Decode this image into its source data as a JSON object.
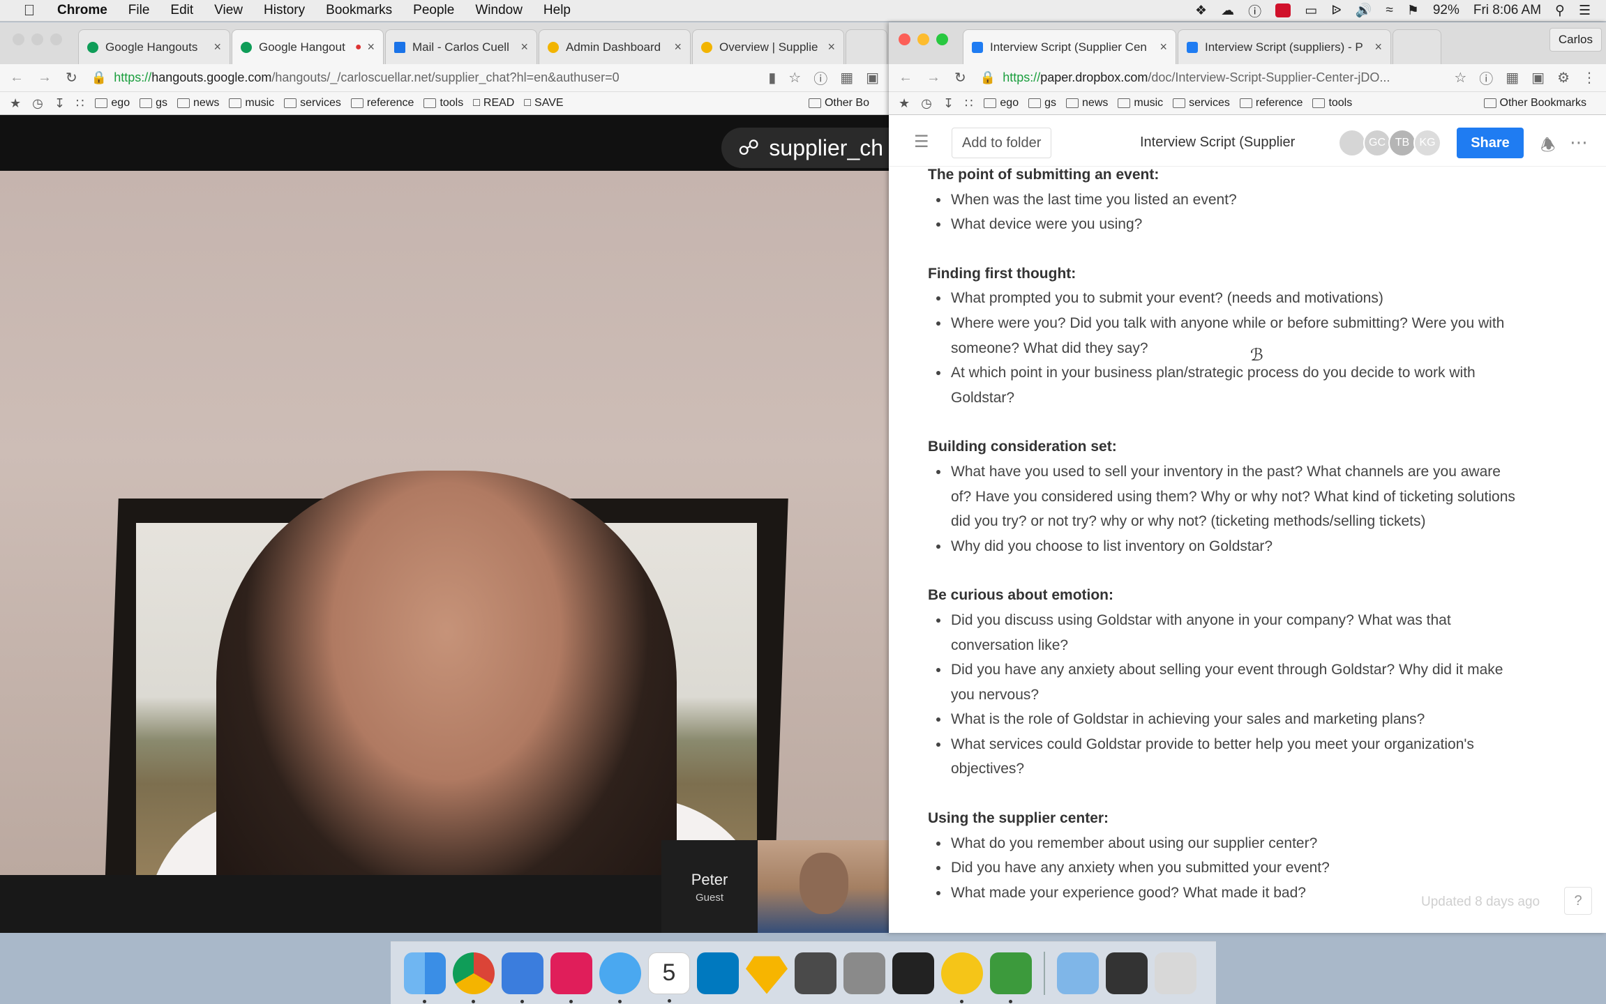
{
  "menubar": {
    "apple": "",
    "app": "Chrome",
    "menus": [
      "File",
      "Edit",
      "View",
      "History",
      "Bookmarks",
      "People",
      "Window",
      "Help"
    ],
    "battery": "92%",
    "clock": "Fri 8:06 AM"
  },
  "left_window": {
    "tabs": [
      {
        "label": "Google Hangouts",
        "color": "#0f9d58"
      },
      {
        "label": "Google Hangout",
        "color": "#0f9d58"
      },
      {
        "label": "Mail - Carlos Cuell",
        "color": "#1a73e8"
      },
      {
        "label": "Admin Dashboard",
        "color": "#f2b400"
      },
      {
        "label": "Overview | Supplie",
        "color": "#f2b400"
      }
    ],
    "url_scheme": "https://",
    "url_domain": "hangouts.google.com",
    "url_path": "/hangouts/_/carloscuellar.net/supplier_chat?hl=en&authuser=0",
    "bookmarks": [
      "ego",
      "gs",
      "news",
      "music",
      "services",
      "reference",
      "tools",
      "READ",
      "SAVE"
    ],
    "other_bookmarks": "Other Bo",
    "chat_name": "supplier_ch",
    "peer_name": "Peter",
    "peer_role": "Guest"
  },
  "right_window": {
    "profile": "Carlos",
    "tabs": [
      {
        "label": "Interview Script (Supplier Cen",
        "color": "#1f7cf2"
      },
      {
        "label": "Interview Script (suppliers) - P",
        "color": "#1f7cf2"
      }
    ],
    "url_scheme": "https://",
    "url_domain": "paper.dropbox.com",
    "url_path": "/doc/Interview-Script-Supplier-Center-jDO...",
    "bookmarks": [
      "ego",
      "gs",
      "news",
      "music",
      "services",
      "reference",
      "tools"
    ],
    "other_bookmarks": "Other Bookmarks",
    "add_to_folder": "Add to folder",
    "doc_title": "Interview Script (Supplier",
    "avatars": [
      {
        "initials": "",
        "color": "#d6d6d6"
      },
      {
        "initials": "GC",
        "color": "#d0d0d0"
      },
      {
        "initials": "TB",
        "color": "#b5b5b5"
      },
      {
        "initials": "KG",
        "color": "#dcdcdc"
      }
    ],
    "share": "Share",
    "updated": "Updated 8 days ago",
    "help": "?"
  },
  "document": {
    "sections": [
      {
        "heading": "The point of submitting an event:",
        "items": [
          "When was the last time you listed an event?",
          "What device were you using?"
        ]
      },
      {
        "heading": "Finding first thought:",
        "items": [
          "What prompted you to submit your event? (needs and motivations)",
          "Where were you? Did you talk with anyone while or before submitting?  Were you with someone? What did they say?",
          "At which point in your business plan/strategic process do you decide to work with Goldstar?"
        ]
      },
      {
        "heading": "Building consideration set:",
        "items": [
          "What have you used to sell your inventory in the past? What channels are you aware of? Have you considered using them? Why or why not? What kind of ticketing solutions did you try? or not try? why or why not? (ticketing methods/selling tickets)",
          "Why did you choose to list inventory on Goldstar?"
        ]
      },
      {
        "heading": "Be curious about emotion:",
        "items": [
          "Did you discuss using Goldstar with anyone in your company? What was that conversation like?",
          "Did you have any anxiety about selling your event through Goldstar? Why did it make you nervous?",
          "What is the role of Goldstar in achieving your sales and marketing plans?",
          "What services could Goldstar provide to better help you meet your organization's objectives?"
        ]
      },
      {
        "heading": "Using the supplier center:",
        "items": [
          "What do you remember about using our supplier center?",
          "Did you have any anxiety when you submitted your event?",
          "What made your experience good? What made it bad?"
        ]
      }
    ]
  },
  "dock": {
    "apps": [
      {
        "name": "finder-icon",
        "color": "#3a8ee6"
      },
      {
        "name": "chrome-icon",
        "color": "#db4437"
      },
      {
        "name": "airmail-icon",
        "color": "#3b7ddd"
      },
      {
        "name": "slack-icon",
        "color": "#e01e5a"
      },
      {
        "name": "messages-icon",
        "color": "#4aa8f0"
      },
      {
        "name": "calendar-icon",
        "color": "#ffffff"
      },
      {
        "name": "trello-icon",
        "color": "#0079bf"
      },
      {
        "name": "sketch-icon",
        "color": "#f7b500"
      },
      {
        "name": "sublime-icon",
        "color": "#4a4a4a"
      },
      {
        "name": "trash-drawer-icon",
        "color": "#8a8a8a"
      },
      {
        "name": "terminal-icon",
        "color": "#222222"
      },
      {
        "name": "idea-icon",
        "color": "#f5c518"
      },
      {
        "name": "camtasia-icon",
        "color": "#3c9a3c"
      },
      {
        "name": "folder-icon",
        "color": "#7fb6e8"
      },
      {
        "name": "screen-icon",
        "color": "#333333"
      },
      {
        "name": "trash-icon",
        "color": "#d8d8d8"
      }
    ],
    "calendar_day": "5"
  }
}
